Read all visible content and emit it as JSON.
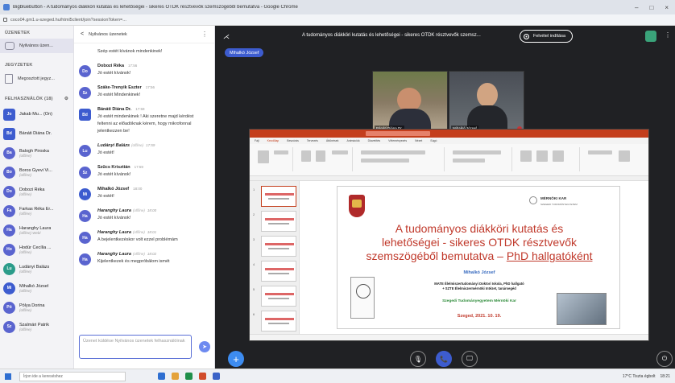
{
  "window": {
    "title": "Bigbluebutton - A tudományos diákköri kutatás és lehetőségei - sikeres OTDK résztvevők szemszögéből bemutatva - Google Chrome",
    "url": "coco04.gm1.u-szeged.hu/html5client/join?sessionToken=...",
    "min": "–",
    "max": "□",
    "close": "×"
  },
  "sidebar": {
    "messages_header": "ÜZENETEK",
    "public_chat": "Nyilvános üzen...",
    "notes_header": "JEGYZETEK",
    "shared_notes": "Megosztott jegyz...",
    "users_header": "FELHASZNÁLÓK (18)",
    "users": [
      {
        "initials": "Jo",
        "name": "Jakab Mu... (Ön)",
        "status": "",
        "color": "#3d5ccf",
        "square": true
      },
      {
        "initials": "Bd",
        "name": "Bánáti Diána Dr.",
        "status": "",
        "color": "#3d5ccf",
        "square": true
      },
      {
        "initials": "Ba",
        "name": "Balogh Piroska",
        "status": "(offline)",
        "color": "#5a64cf",
        "square": false
      },
      {
        "initials": "Bo",
        "name": "Boros Gyevi Vi...",
        "status": "(offline)",
        "color": "#5a64cf",
        "square": false
      },
      {
        "initials": "Do",
        "name": "Dobozi Réka",
        "status": "(offline)",
        "color": "#5a64cf",
        "square": false
      },
      {
        "initials": "Fa",
        "name": "Farkas Réka Er...",
        "status": "(offline)",
        "color": "#5a64cf",
        "square": false
      },
      {
        "initials": "Ha",
        "name": "Haranghy Laura",
        "status": "(offline) Webl",
        "color": "#5a64cf",
        "square": false
      },
      {
        "initials": "Ho",
        "name": "Hodúr Cecília ...",
        "status": "(offline)",
        "color": "#5a64cf",
        "square": false
      },
      {
        "initials": "Lu",
        "name": "Ludányi Balázs",
        "status": "(offline)",
        "color": "#2b9c8a",
        "square": false
      },
      {
        "initials": "Mi",
        "name": "Mihalkó József",
        "status": "(offline)",
        "color": "#3d5ccf",
        "square": false
      },
      {
        "initials": "Pó",
        "name": "Pólya Dorina",
        "status": "(offline)",
        "color": "#5a64cf",
        "square": false
      },
      {
        "initials": "Sz",
        "name": "Szalmári Patrik",
        "status": "(offline)",
        "color": "#5a64cf",
        "square": false
      }
    ]
  },
  "chat": {
    "back_label": "<",
    "title": "Nyilvános üzenetek",
    "menu": "⋮",
    "messages": [
      {
        "initials": "",
        "name": "",
        "time": "",
        "offline": "",
        "italic": false,
        "text": "Szép estét kívánok mindenkinek!",
        "color": "#5a64cf"
      },
      {
        "initials": "Do",
        "name": "Dobozi Réka",
        "time": "17:56",
        "offline": "",
        "italic": false,
        "text": "Jó estét kívánok!",
        "color": "#5a64cf"
      },
      {
        "initials": "Sz",
        "name": "Száke-Trenyik Eszter",
        "time": "17:56",
        "offline": "",
        "italic": false,
        "text": "Jó estét Mindenkinek!",
        "color": "#5a64cf"
      },
      {
        "initials": "Bd",
        "name": "Bánáti Diána Dr.",
        "time": "17:59",
        "offline": "",
        "italic": false,
        "text": "Jó estét mindenkinek ! Aki szeretne majd kérdést feltenni az előadóknak kérem, hogy mikrofonnal jelentkezzen be!",
        "color": "#3d5ccf"
      },
      {
        "initials": "Lu",
        "name": "Ludányi Balázs",
        "time": "17:59",
        "offline": "(offline)",
        "italic": true,
        "text": "Jó estét!",
        "color": "#5a64cf"
      },
      {
        "initials": "Sz",
        "name": "Szűcs Krisztián",
        "time": "17:59",
        "offline": "",
        "italic": false,
        "text": "Jó estét kívánok!",
        "color": "#5a64cf"
      },
      {
        "initials": "Mi",
        "name": "Mihalkó József",
        "time": "18:00",
        "offline": "",
        "italic": false,
        "text": "Jó estét!",
        "color": "#3d5ccf"
      },
      {
        "initials": "Ha",
        "name": "Haranghy Laura",
        "time": "18:00",
        "offline": "(offline)",
        "italic": true,
        "text": "Jó estét kívánok!",
        "color": "#5a64cf"
      },
      {
        "initials": "Ha",
        "name": "Haranghy Laura",
        "time": "18:01",
        "offline": "(offline)",
        "italic": true,
        "text": "A bejelentkezéskor volt ezzel problémám",
        "color": "#5a64cf"
      },
      {
        "initials": "Ha",
        "name": "Haranghy Laura",
        "time": "18:02",
        "offline": "(offline)",
        "italic": true,
        "text": "Kijelentkezek és megpróbálom ismét",
        "color": "#5a64cf"
      }
    ],
    "compose_placeholder": "Üzenet küldése Nyilvános üzenetek felhasználóinak",
    "send_glyph": "➤"
  },
  "meeting": {
    "back_glyph": "⋌",
    "title": "A tudományos diákköri kutatás és lehetőségei - sikeres OTDK résztvevők szemsz...",
    "record_label": "Felvétel indítása",
    "more_glyph": "⋮",
    "presenter_pill": "Mihalkó József",
    "tile1_label": "Bánáti Diána Dr.",
    "tile2_label": "Mihalkó József",
    "fab_glyph": "+",
    "control_glyphs": [
      "🎙",
      "📞",
      "🖵"
    ],
    "end_glyph": "⏻"
  },
  "slide": {
    "ribbon_tabs": [
      "Fájl",
      "Kezdőlap",
      "Beszúrás",
      "Tervezés",
      "Áttűnések",
      "Animációk",
      "Diavetítés",
      "Véleményezés",
      "Nézet",
      "Súgó"
    ],
    "univ_name": "MÉRNÖKI KAR",
    "univ_sub": "SZEGEDI TUDOMÁNYEGYETEM",
    "title_line1": "A tudományos diákköri kutatás és",
    "title_line2": "lehetőségei - sikeres OTDK résztvevők",
    "title_line3a": "szemszögéből bemutatva – ",
    "title_line3b": "PhD hallgatóként",
    "author": "Mihalkó József",
    "aff1": "MATE Élelmiszertudományi Doktori Iskola, PhD hallgató",
    "aff2": "+ SZTE Élelmiszermérnöki Intézet, tanársegéd",
    "org": "Szegedi Tudományegyetem Mérnöki Kar",
    "date": "Szeged, 2021. 10. 19.",
    "thumb_nums": [
      "1",
      "2",
      "3",
      "4",
      "5",
      "6"
    ]
  },
  "taskbar": {
    "search_placeholder": "Írjon ide a kereséshez",
    "weather": "17°C Tiszta égbolt",
    "time": "18:21"
  }
}
